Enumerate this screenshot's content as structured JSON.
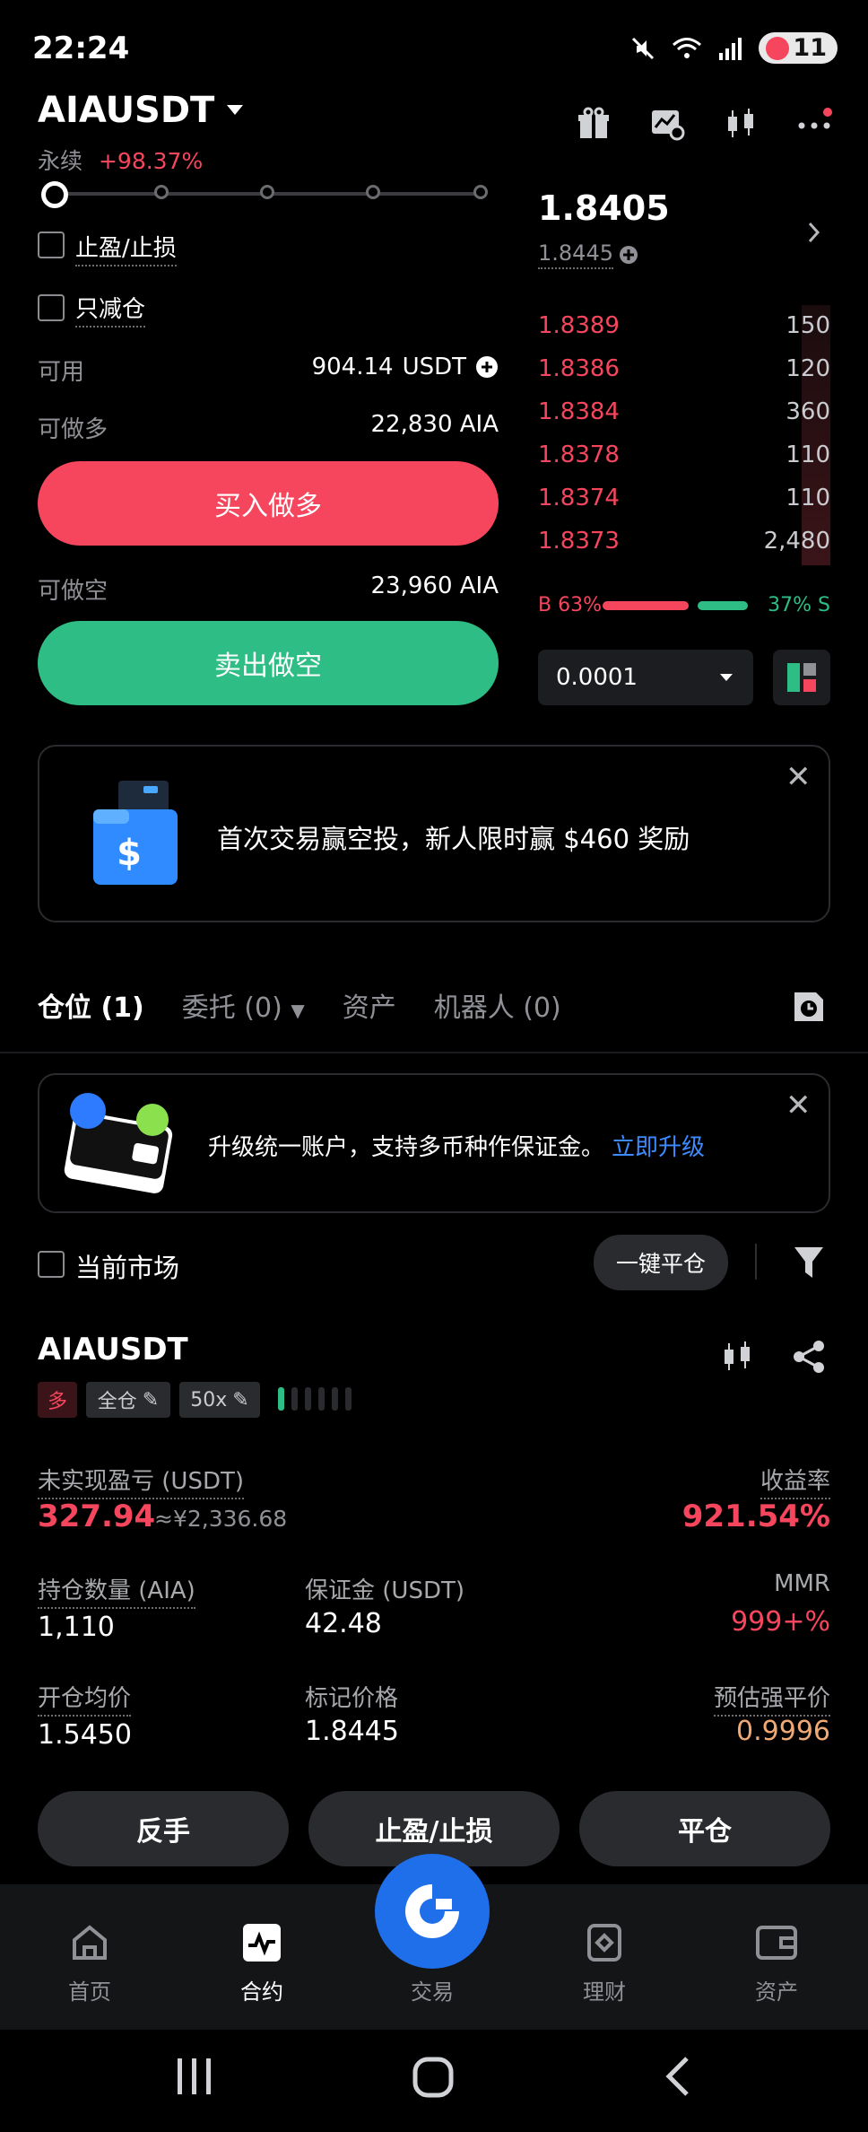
{
  "status": {
    "time": "22:24",
    "battery": "11"
  },
  "header": {
    "pair": "AIAUSDT",
    "type": "永续",
    "change": "+98.37%"
  },
  "order_form": {
    "tp_sl_label": "止盈/止损",
    "reduce_only_label": "只减仓",
    "available_label": "可用",
    "available_value": "904.14",
    "available_unit": "USDT",
    "long_label": "可做多",
    "long_value": "22,830 AIA",
    "buy_button": "买入做多",
    "short_label": "可做空",
    "short_value": "23,960 AIA",
    "sell_button": "卖出做空"
  },
  "order_book": {
    "last_price": "1.8405",
    "mark_price": "1.8445",
    "asks": [
      {
        "price": "1.8389",
        "qty": "150"
      },
      {
        "price": "1.8386",
        "qty": "120"
      },
      {
        "price": "1.8384",
        "qty": "360"
      },
      {
        "price": "1.8378",
        "qty": "110"
      },
      {
        "price": "1.8374",
        "qty": "110"
      },
      {
        "price": "1.8373",
        "qty": "2,480"
      }
    ],
    "buy_ratio_label": "B 63%",
    "sell_ratio_label": "37% S",
    "buy_ratio": 0.63,
    "precision": "0.0001"
  },
  "promo": {
    "text": "首次交易赢空投，新人限时赢 $460 奖励",
    "wallet_tag": "$"
  },
  "tabs": {
    "positions": "仓位 (1)",
    "orders": "委托 (0)",
    "assets": "资产",
    "bots": "机器人 (0)"
  },
  "upgrade": {
    "text": "升级统一账户，支持多币种作保证金。",
    "link": "立即升级"
  },
  "filter": {
    "current_market": "当前市场",
    "close_all": "一键平仓"
  },
  "position": {
    "symbol": "AIAUSDT",
    "side": "多",
    "margin_mode": "全仓",
    "leverage": "50x",
    "upnl_label": "未实现盈亏 (USDT)",
    "upnl_value": "327.94",
    "upnl_cny": "≈¥2,336.68",
    "roe_label": "收益率",
    "roe_value": "921.54%",
    "size_label": "持仓数量 (AIA)",
    "size_value": "1,110",
    "margin_label": "保证金 (USDT)",
    "margin_value": "42.48",
    "mmr_label": "MMR",
    "mmr_value": "999+%",
    "entry_label": "开仓均价",
    "entry_value": "1.5450",
    "mark_label": "标记价格",
    "mark_value": "1.8445",
    "liq_label": "预估强平价",
    "liq_value": "0.9996",
    "reverse_button": "反手",
    "tpsl_button": "止盈/止损",
    "close_button": "平仓"
  },
  "nav": {
    "home": "首页",
    "futures": "合约",
    "trade": "交易",
    "earn": "理财",
    "assets": "资产"
  },
  "colors": {
    "red": "#f6465d",
    "green": "#2ebd85",
    "blue": "#1f6feb",
    "orange": "#f0a875"
  }
}
